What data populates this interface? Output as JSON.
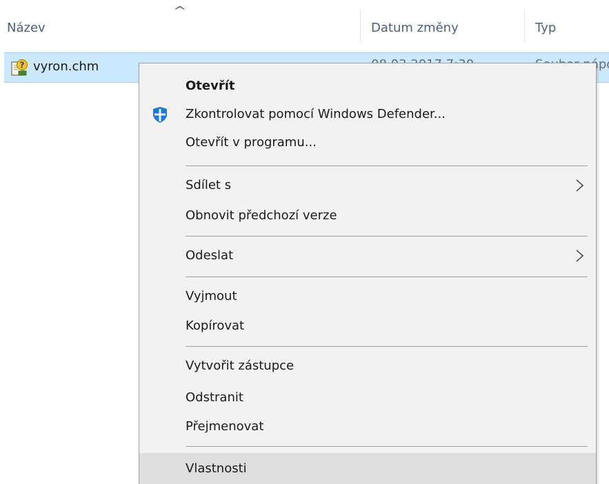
{
  "columns": {
    "name": "Název",
    "date": "Datum změny",
    "type": "Typ",
    "sort_glyph": "^"
  },
  "file": {
    "name": "vyron.chm",
    "date_partial": "08.03.2017 7:30",
    "type_partial": "Soubor nápo",
    "icon": "chm-help-file-icon",
    "selected_bg": "#cce8ff"
  },
  "menu": {
    "items": [
      {
        "label": "Otevřít",
        "bold": true
      },
      {
        "label": "Zkontrolovat pomocí Windows Defender...",
        "icon": "windows-defender-shield-icon"
      },
      {
        "label": "Otevřít v programu..."
      },
      {
        "label": "Sdílet s",
        "submenu": true
      },
      {
        "label": "Obnovit předchozí verze"
      },
      {
        "label": "Odeslat",
        "submenu": true
      },
      {
        "label": "Vyjmout"
      },
      {
        "label": "Kopírovat"
      },
      {
        "label": "Vytvořit zástupce"
      },
      {
        "label": "Odstranit"
      },
      {
        "label": "Přejmenovat"
      },
      {
        "label": "Vlastnosti",
        "highlighted": true
      }
    ],
    "accent_color": "#1e78d6",
    "hover_bg": "#dedede"
  }
}
